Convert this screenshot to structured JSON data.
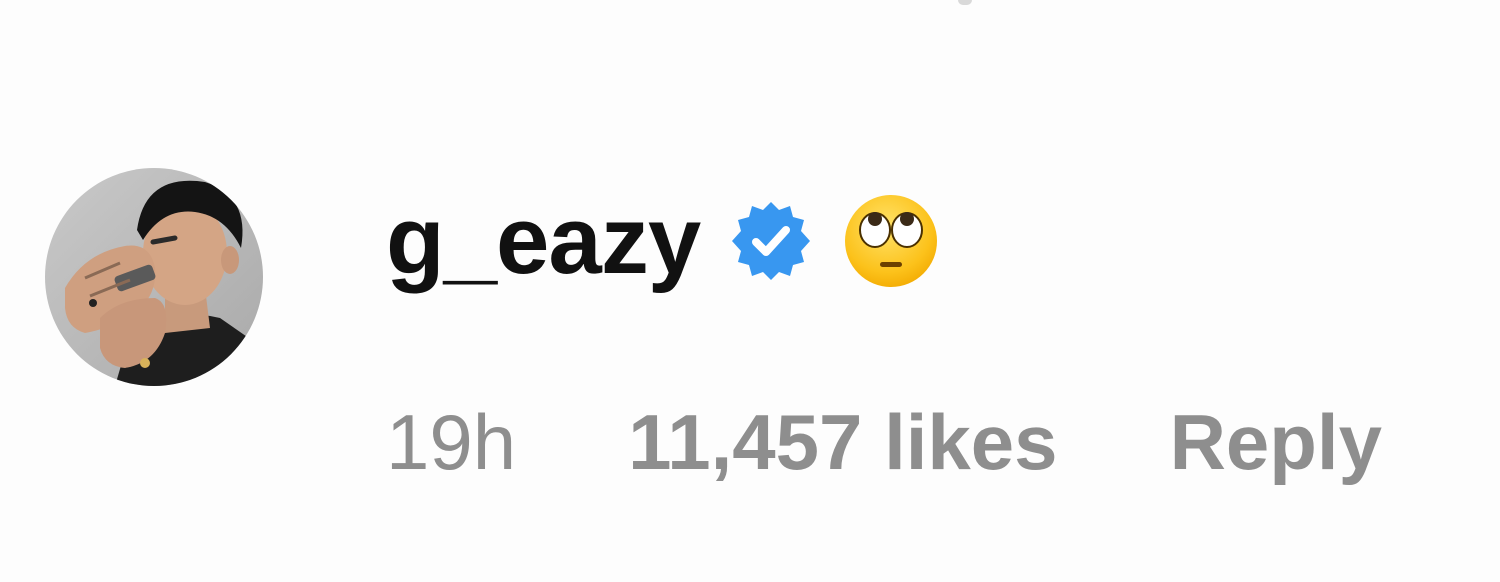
{
  "comment": {
    "username": "g_eazy",
    "verified": true,
    "text_emoji": "face-with-rolling-eyes",
    "timestamp": "19h",
    "likes": "11,457 likes",
    "reply_label": "Reply"
  },
  "colors": {
    "username": "#111111",
    "meta": "#8e8e8e",
    "verified_badge": "#3897f0",
    "background": "#fdfdfd"
  }
}
